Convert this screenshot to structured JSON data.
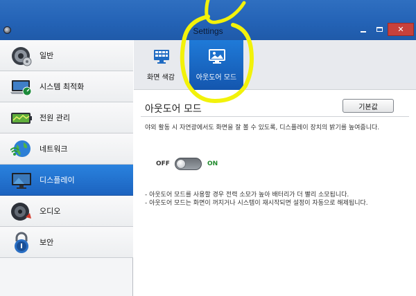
{
  "window": {
    "title": "Settings",
    "close_glyph": "✕"
  },
  "sidebar": {
    "items": [
      {
        "label": "일반",
        "icon": "speaker-gear-icon"
      },
      {
        "label": "시스템 최적화",
        "icon": "laptop-gauge-icon"
      },
      {
        "label": "전원 관리",
        "icon": "battery-icon"
      },
      {
        "label": "네트워크",
        "icon": "globe-wifi-icon"
      },
      {
        "label": "디스플레이",
        "icon": "monitor-icon",
        "selected": true
      },
      {
        "label": "오디오",
        "icon": "audio-speaker-icon"
      },
      {
        "label": "보안",
        "icon": "padlock-icon"
      }
    ]
  },
  "tabs": [
    {
      "label": "화면 색감",
      "icon": "screen-color-icon"
    },
    {
      "label": "아웃도어 모드",
      "icon": "outdoor-mode-icon",
      "active": true
    }
  ],
  "content": {
    "title": "아웃도어 모드",
    "reset_button": "기본값",
    "description": "야외 활동 시 자연광에서도 화면을 잘 볼 수 있도록, 디스플레이 장치의 밝기를 높여줍니다.",
    "toggle": {
      "off_label": "OFF",
      "on_label": "ON",
      "state": "off"
    },
    "notes": [
      "- 아웃도어 모드를 사용할 경우 전력 소모가 높아 배터리가 더 빨리 소모됩니다.",
      "- 아웃도어 모드는 화면이 꺼지거나 시스템이 재시작되면 설정이 자동으로 해제됩니다."
    ]
  },
  "colors": {
    "accent": "#1c63bf",
    "highlight_annotation": "#f2f20a",
    "on_label": "#1f8a2b"
  }
}
